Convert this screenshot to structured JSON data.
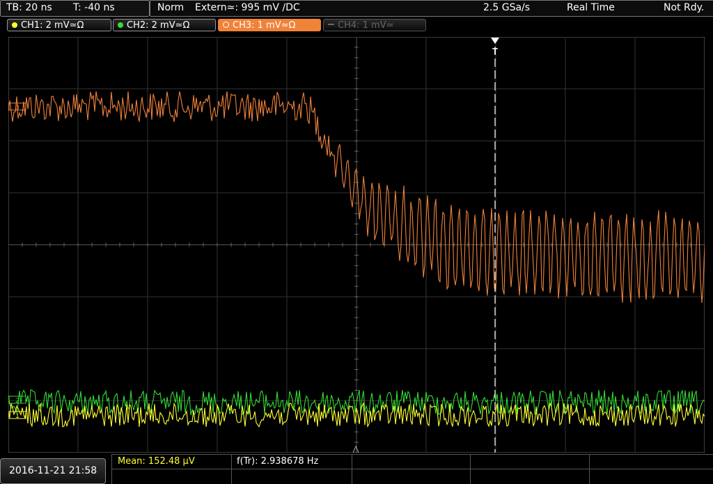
{
  "header": {
    "timebase": "TB: 20 ns",
    "trigger_time": "T: -40 ns",
    "mode": "Norm",
    "trigger_source": "Extern≃: 995 mV ∕DC",
    "sample_rate": "2.5 GSa/s",
    "acquisition": "Real Time",
    "status": "Not Rdy."
  },
  "channels": [
    {
      "label": "CH1: 2 mV≃Ω",
      "color": "#ffff33",
      "state": "on"
    },
    {
      "label": "CH2: 2 mV≃Ω",
      "color": "#33dd33",
      "state": "on"
    },
    {
      "label": "CH3: 1 mV≃Ω",
      "color": "#f0823a",
      "state": "active"
    },
    {
      "label": "CH4: 1 mV≃",
      "color": "#666666",
      "state": "off"
    }
  ],
  "markers": {
    "ch3": "3",
    "ch2": "2",
    "ch1": "1",
    "trigger": "T"
  },
  "measurements": {
    "mean": "Mean: 152.48 µV",
    "frequency": "f(Tr): 2.938678 Hz"
  },
  "datetime": "2016-11-21 21:58",
  "colors": {
    "ch1": "#ffff33",
    "ch2": "#33dd33",
    "ch3": "#f0823a",
    "grid": "#3a3a3a"
  }
}
